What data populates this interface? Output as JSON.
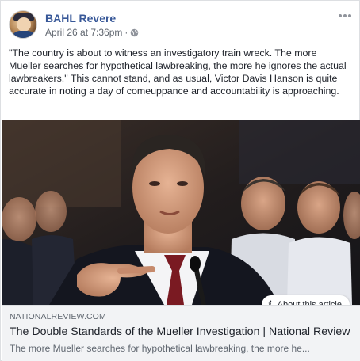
{
  "post": {
    "author": "BAHL Revere",
    "timestamp": "April 26 at 7:36pm",
    "separator": "·",
    "privacy_icon": "globe-icon",
    "menu_icon": "more-options-icon",
    "text": "\"The country is about to witness an investigatory train wreck. The more Mueller searches for hypothetical lawbreaking, the more he ignores the actual lawbreakers.\" This cannot stand, and as usual, Victor Davis Hanson is quite accurate in noting a day of comeuppance and accountability is approaching."
  },
  "link_preview": {
    "about_label": "About this article",
    "about_icon": "info-icon",
    "domain": "NATIONALREVIEW.COM",
    "title": "The Double Standards of the Mueller Investigation | National Review",
    "description": "The more Mueller searches for hypothetical lawbreaking, the more he..."
  },
  "colors": {
    "author_link": "#385898",
    "meta_gray": "#616770",
    "preview_bg": "#f2f3f5"
  }
}
